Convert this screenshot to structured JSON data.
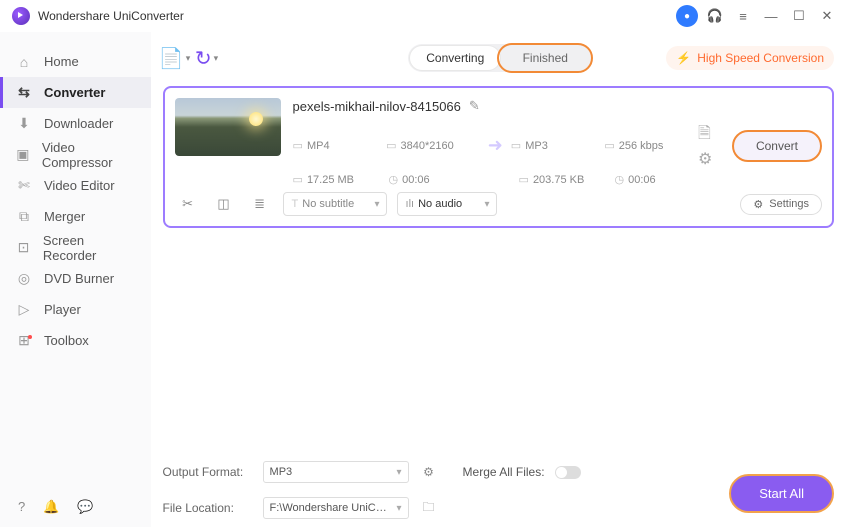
{
  "app": {
    "title": "Wondershare UniConverter"
  },
  "titlebar_icons": {
    "avatar": "user-avatar",
    "headset": "support-icon",
    "menu": "menu-icon",
    "min": "minimize-icon",
    "max": "maximize-icon",
    "close": "close-icon"
  },
  "sidebar": {
    "items": [
      {
        "label": "Home",
        "icon": "⌂"
      },
      {
        "label": "Converter",
        "icon": "⇆"
      },
      {
        "label": "Downloader",
        "icon": "⬇"
      },
      {
        "label": "Video Compressor",
        "icon": "▣"
      },
      {
        "label": "Video Editor",
        "icon": "✄"
      },
      {
        "label": "Merger",
        "icon": "⧉"
      },
      {
        "label": "Screen Recorder",
        "icon": "⊡"
      },
      {
        "label": "DVD Burner",
        "icon": "◎"
      },
      {
        "label": "Player",
        "icon": "▷"
      },
      {
        "label": "Toolbox",
        "icon": "⊞"
      }
    ]
  },
  "tabs": {
    "converting": "Converting",
    "finished": "Finished"
  },
  "hsc": "High Speed Conversion",
  "file": {
    "name": "pexels-mikhail-nilov-8415066",
    "src": {
      "fmt": "MP4",
      "res": "3840*2160",
      "size": "17.25 MB",
      "dur": "00:06"
    },
    "dst": {
      "fmt": "MP3",
      "bitrate": "256 kbps",
      "size": "203.75 KB",
      "dur": "00:06"
    },
    "subtitle": "No subtitle",
    "audio": "No audio",
    "settings": "Settings",
    "convert": "Convert"
  },
  "footer": {
    "output_format_label": "Output Format:",
    "output_format": "MP3",
    "file_location_label": "File Location:",
    "file_location": "F:\\Wondershare UniConverter",
    "merge_label": "Merge All Files:",
    "start_all": "Start All"
  }
}
